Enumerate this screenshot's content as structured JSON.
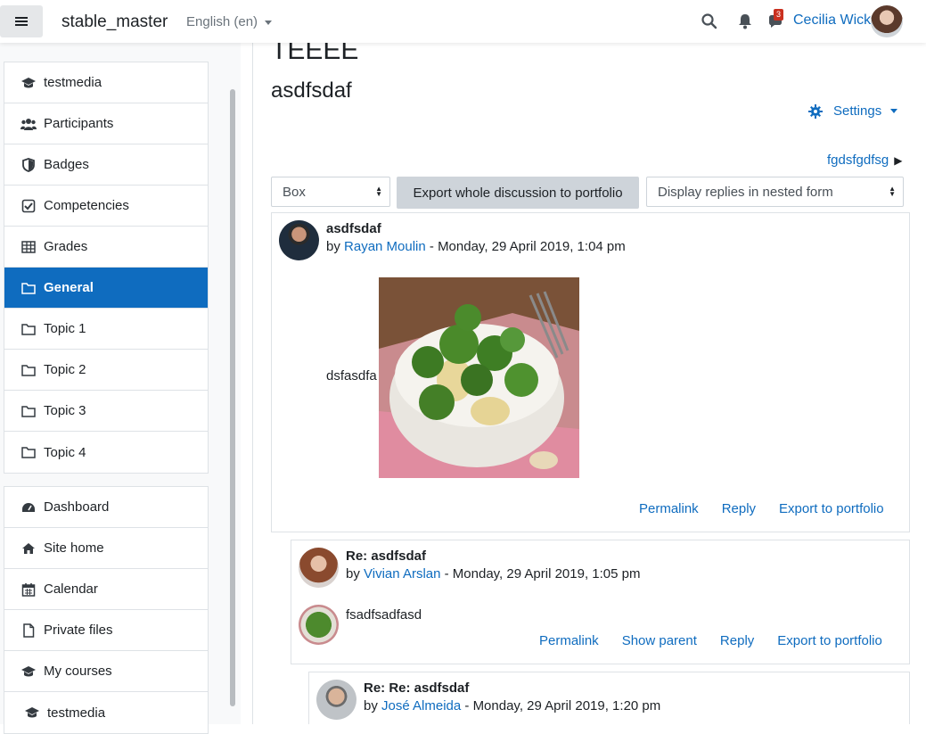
{
  "navbar": {
    "brand": "stable_master",
    "language": "English (en)",
    "message_count": "3",
    "user_name": "Cecilia Wick"
  },
  "sidebar": {
    "course_items": [
      {
        "label": "testmedia",
        "icon": "mortarboard-icon"
      },
      {
        "label": "Participants",
        "icon": "users-icon"
      },
      {
        "label": "Badges",
        "icon": "shield-icon"
      },
      {
        "label": "Competencies",
        "icon": "checkbox-icon"
      },
      {
        "label": "Grades",
        "icon": "table-icon"
      },
      {
        "label": "General",
        "icon": "folder-icon",
        "active": true
      },
      {
        "label": "Topic 1",
        "icon": "folder-icon"
      },
      {
        "label": "Topic 2",
        "icon": "folder-icon"
      },
      {
        "label": "Topic 3",
        "icon": "folder-icon"
      },
      {
        "label": "Topic 4",
        "icon": "folder-icon"
      }
    ],
    "site_items": [
      {
        "label": "Dashboard",
        "icon": "dashboard-icon"
      },
      {
        "label": "Site home",
        "icon": "home-icon"
      },
      {
        "label": "Calendar",
        "icon": "calendar-icon"
      },
      {
        "label": "Private files",
        "icon": "file-icon"
      },
      {
        "label": "My courses",
        "icon": "mortarboard-icon"
      },
      {
        "label": "testmedia",
        "icon": "mortarboard-icon"
      }
    ]
  },
  "main": {
    "heading": "TEEEE",
    "subheading": "asdfsdaf",
    "settings_label": "Settings",
    "next_discussion": "fgdsfgdfsg",
    "group_select": "Box",
    "export_button": "Export whole discussion to portfolio",
    "display_mode": "Display replies in nested form"
  },
  "posts": [
    {
      "subject": "asdfsdaf",
      "by": "by",
      "author": "Rayan Moulin",
      "date": " - Monday, 29 April 2019, 1:04 pm",
      "body": "dsfasdfa",
      "links": [
        "Permalink",
        "Reply",
        "Export to portfolio"
      ]
    },
    {
      "subject": "Re: asdfsdaf",
      "by": "by",
      "author": "Vivian Arslan",
      "date": " - Monday, 29 April 2019, 1:05 pm",
      "body": "fsadfsadfasd",
      "links": [
        "Permalink",
        "Show parent",
        "Reply",
        "Export to portfolio"
      ]
    },
    {
      "subject": "Re: Re: asdfsdaf",
      "by": "by",
      "author": "José Almeida",
      "date": " - Monday, 29 April 2019, 1:20 pm"
    }
  ],
  "colors": {
    "primary": "#0f6cbf",
    "notification": "#ca3120"
  }
}
